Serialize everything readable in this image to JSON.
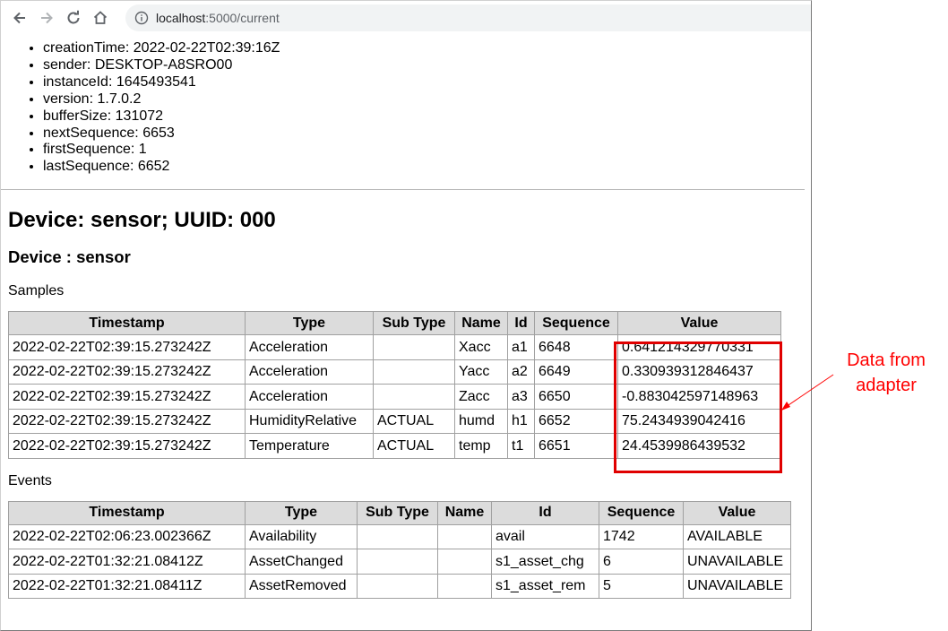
{
  "browser": {
    "url_host": "localhost",
    "url_path": ":5000/current"
  },
  "header": {
    "items": [
      "creationTime: 2022-02-22T02:39:16Z",
      "sender: DESKTOP-A8SRO00",
      "instanceId: 1645493541",
      "version: 1.7.0.2",
      "bufferSize: 131072",
      "nextSequence: 6653",
      "firstSequence: 1",
      "lastSequence: 6652"
    ]
  },
  "device": {
    "title": "Device: sensor; UUID: 000",
    "subtitle": "Device : sensor"
  },
  "samples": {
    "label": "Samples",
    "columns": [
      "Timestamp",
      "Type",
      "Sub Type",
      "Name",
      "Id",
      "Sequence",
      "Value"
    ],
    "rows": [
      [
        "2022-02-22T02:39:15.273242Z",
        "Acceleration",
        "",
        "Xacc",
        "a1",
        "6648",
        "0.641214329770331"
      ],
      [
        "2022-02-22T02:39:15.273242Z",
        "Acceleration",
        "",
        "Yacc",
        "a2",
        "6649",
        "0.330939312846437"
      ],
      [
        "2022-02-22T02:39:15.273242Z",
        "Acceleration",
        "",
        "Zacc",
        "a3",
        "6650",
        "-0.883042597148963"
      ],
      [
        "2022-02-22T02:39:15.273242Z",
        "HumidityRelative",
        "ACTUAL",
        "humd",
        "h1",
        "6652",
        "75.2434939042416"
      ],
      [
        "2022-02-22T02:39:15.273242Z",
        "Temperature",
        "ACTUAL",
        "temp",
        "t1",
        "6651",
        "24.4539986439532"
      ]
    ]
  },
  "events": {
    "label": "Events",
    "columns": [
      "Timestamp",
      "Type",
      "Sub Type",
      "Name",
      "Id",
      "Sequence",
      "Value"
    ],
    "rows": [
      [
        "2022-02-22T02:06:23.002366Z",
        "Availability",
        "",
        "",
        "avail",
        "1742",
        "AVAILABLE"
      ],
      [
        "2022-02-22T01:32:21.08412Z",
        "AssetChanged",
        "",
        "",
        "s1_asset_chg",
        "6",
        "UNAVAILABLE"
      ],
      [
        "2022-02-22T01:32:21.08411Z",
        "AssetRemoved",
        "",
        "",
        "s1_asset_rem",
        "5",
        "UNAVAILABLE"
      ]
    ]
  },
  "annotation": {
    "line1": "Data from",
    "line2": "adapter",
    "color": "#ff0000"
  }
}
